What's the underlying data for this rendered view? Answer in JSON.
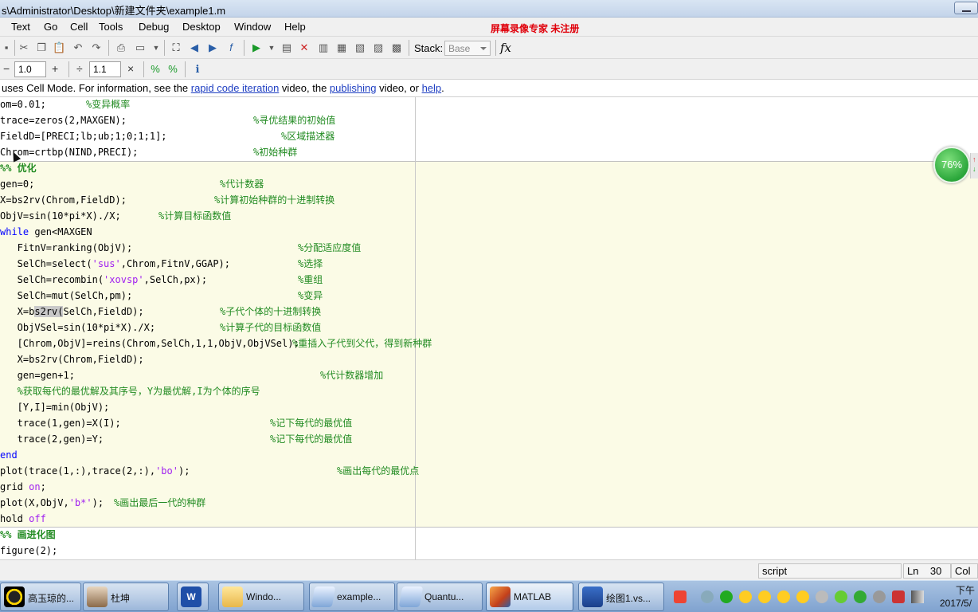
{
  "window": {
    "title": "s\\Administrator\\Desktop\\新建文件夹\\example1.m"
  },
  "menu": {
    "items": [
      "Text",
      "Go",
      "Cell",
      "Tools",
      "Debug",
      "Desktop",
      "Window",
      "Help"
    ],
    "watermark": "屏幕录像专家  未注册"
  },
  "toolbar": {
    "stack_label": "Stack:",
    "stack_value": "Base",
    "fx_label": "fx"
  },
  "cell_toolbar": {
    "decrement_value": "1.0",
    "divide_value": "1.1",
    "minus": "−",
    "plus": "+",
    "divide": "÷",
    "times": "×"
  },
  "infobar": {
    "prefix": " uses Cell Mode. For information, see the ",
    "link1": "rapid code iteration",
    "mid1": " video, the ",
    "link2": "publishing",
    "mid2": " video, or ",
    "link3": "help",
    "suffix": "."
  },
  "code": {
    "l01": "om=0.01;",
    "c01": "%变异概率",
    "l02": "trace=zeros(2,MAXGEN);",
    "c02": "%寻优结果的初始值",
    "l03": "FieldD=[PRECI;lb;ub;1;0;1;1];",
    "c03": "%区域描述器",
    "l04": "Chrom=crtbp(NIND,PRECI);",
    "c04": "%初始种群",
    "l05": "%% 优化",
    "l06": "gen=0;",
    "c06": "%代计数器",
    "l07": "X=bs2rv(Chrom,FieldD);",
    "c07": "%计算初始种群的十进制转换",
    "l08": "ObjV=sin(10*pi*X)./X;",
    "c08": "%计算目标函数值",
    "l09_kw": "while",
    "l09": " gen<MAXGEN",
    "l10": "   FitnV=ranking(ObjV);",
    "c10": "%分配适应度值",
    "l11_a": "   SelCh=select(",
    "l11_s": "'sus'",
    "l11_b": ",Chrom,FitnV,GGAP);",
    "c11": "%选择",
    "l12_a": "   SelCh=recombin(",
    "l12_s": "'xovsp'",
    "l12_b": ",SelCh,px);",
    "c12": "%重组",
    "l13": "   SelCh=mut(SelCh,pm);",
    "c13": "%变异",
    "l14_a": "   X=b",
    "l14_sel": "s2rv(",
    "l14_b": "SelCh,FieldD);",
    "c14": "%子代个体的十进制转换",
    "l15": "   ObjVSel=sin(10*pi*X)./X;",
    "c15": "%计算子代的目标函数值",
    "l16": "   [Chrom,ObjV]=reins(Chrom,SelCh,1,1,ObjV,ObjVSel);",
    "c16": "%重插入子代到父代，得到新种群",
    "l17": "   X=bs2rv(Chrom,FieldD);",
    "l18": "   gen=gen+1;",
    "c18": "%代计数器增加",
    "l19": "   %获取每代的最优解及其序号，Y为最优解,I为个体的序号",
    "l20": "   [Y,I]=min(ObjV);",
    "l21": "   trace(1,gen)=X(I);",
    "c21": "%记下每代的最优值",
    "l22": "   trace(2,gen)=Y;",
    "c22": "%记下每代的最优值",
    "l23_kw": "end",
    "l24_a": "plot(trace(1,:),trace(2,:),",
    "l24_s": "'bo'",
    "l24_b": ");",
    "c24": "%画出每代的最优点",
    "l25": "grid ",
    "l25_s": "on",
    "l25_b": ";",
    "l26_a": "plot(X,ObjV,",
    "l26_s": "'b*'",
    "l26_b": ");",
    "c26": "%画出最后一代的种群",
    "l27": "hold ",
    "l27_s": "off",
    "l28": "%% 画进化图",
    "l29": "figure(2);"
  },
  "badge": {
    "percent": "76%"
  },
  "status": {
    "mode": "script",
    "ln_label": "Ln",
    "ln_value": "30",
    "col_label": "Col"
  },
  "taskbar": {
    "items": [
      "高玉琼的...",
      "杜坤",
      "",
      "Windo...",
      "example...",
      "Quantu...",
      "MATLAB",
      "绘图1.vs..."
    ],
    "clock_time": "下午",
    "clock_date": "2017/5/"
  },
  "colors": {
    "keyword": "#0000ff",
    "string": "#a020f0",
    "comment": "#228b22",
    "cell_highlight": "#fbfbe6",
    "watermark": "#e0000b",
    "link": "#1f3fc2"
  }
}
